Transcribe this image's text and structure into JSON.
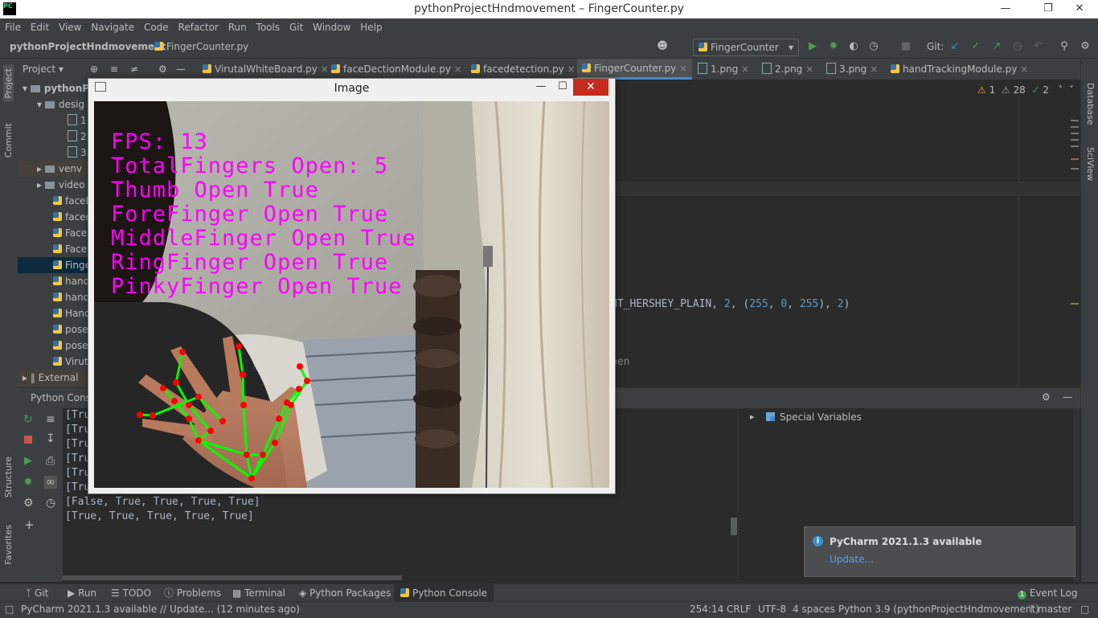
{
  "window": {
    "title": "pythonProjectHndmovement – FingerCounter.py",
    "logo": "PC"
  },
  "menu": [
    "File",
    "Edit",
    "View",
    "Navigate",
    "Code",
    "Refactor",
    "Run",
    "Tools",
    "Git",
    "Window",
    "Help"
  ],
  "breadcrumb": {
    "project": "pythonProjectHndmovement",
    "file": "FingerCounter.py"
  },
  "toolbar": {
    "run_config": "FingerCounter",
    "git_label": "Git:"
  },
  "tabs": [
    {
      "label": "VirutalWhiteBoard.py"
    },
    {
      "label": "faceDectionModule.py"
    },
    {
      "label": "facedetection.py"
    },
    {
      "label": "FingerCounter.py"
    },
    {
      "label": "1.png"
    },
    {
      "label": "2.png"
    },
    {
      "label": "3.png"
    },
    {
      "label": "handTrackingModule.py"
    }
  ],
  "project_panel": {
    "header": "Project",
    "rows": [
      "pythonP",
      "desig",
      "1.",
      "2.",
      "3.",
      "venv",
      "video",
      "faceD",
      "faced",
      "FaceD",
      "FaceD",
      "Finge",
      "hand",
      "hand",
      "Hand",
      "pose",
      "pose",
      "Virut",
      "External"
    ]
  },
  "side_labels": {
    "project": "Project",
    "commit": "Commit",
    "structure": "Structure",
    "favorites": "Favorites",
    "database": "Database",
    "sciview": "SciView"
  },
  "inspections": {
    "warnings": "1",
    "weak_warnings": "28",
    "ok": "2"
  },
  "editor": {
    "line1_prefix": "NT_HERSHEY_PLAIN, ",
    "line1_n1": "2",
    "line1_sep": ", (",
    "line1_r": "255",
    "line1_g": "0",
    "line1_b": "255",
    "line1_close": "), ",
    "line1_n2": "2",
    "line1_end": ")",
    "line2": "pen"
  },
  "console": {
    "title": "Python Console",
    "lines": [
      "[Tru",
      "[Tru",
      "[Tru",
      "[Tru",
      "[Tru",
      "[Tru",
      "[False, True, True, True, True]",
      "[True, True, True, True, True]"
    ],
    "special_variables": "Special Variables"
  },
  "image_window": {
    "title": "Image",
    "overlay": [
      "FPS: 13",
      "TotalFingers Open: 5",
      "Thumb Open True",
      "ForeFinger Open True",
      "MiddleFinger Open True",
      "RingFinger Open True",
      "PinkyFinger Open True"
    ]
  },
  "notification": {
    "title": "PyCharm 2021.1.3 available",
    "link": "Update..."
  },
  "bottom_tabs": [
    "Git",
    "Run",
    "TODO",
    "Problems",
    "Terminal",
    "Python Packages",
    "Python Console"
  ],
  "event_log": "Event Log",
  "status": {
    "message": "PyCharm 2021.1.3 available // Update... (12 minutes ago)",
    "position": "254:14",
    "line_sep": "CRLF",
    "encoding": "UTF-8",
    "indent": "4 spaces",
    "interpreter": "Python 3.9 (pythonProjectHndmovement)",
    "branch": "master"
  },
  "colors": {
    "overlay": "#ff00ff",
    "landmark": "#ff0000",
    "connection": "#00ff00",
    "accent": "#4a88c7"
  }
}
